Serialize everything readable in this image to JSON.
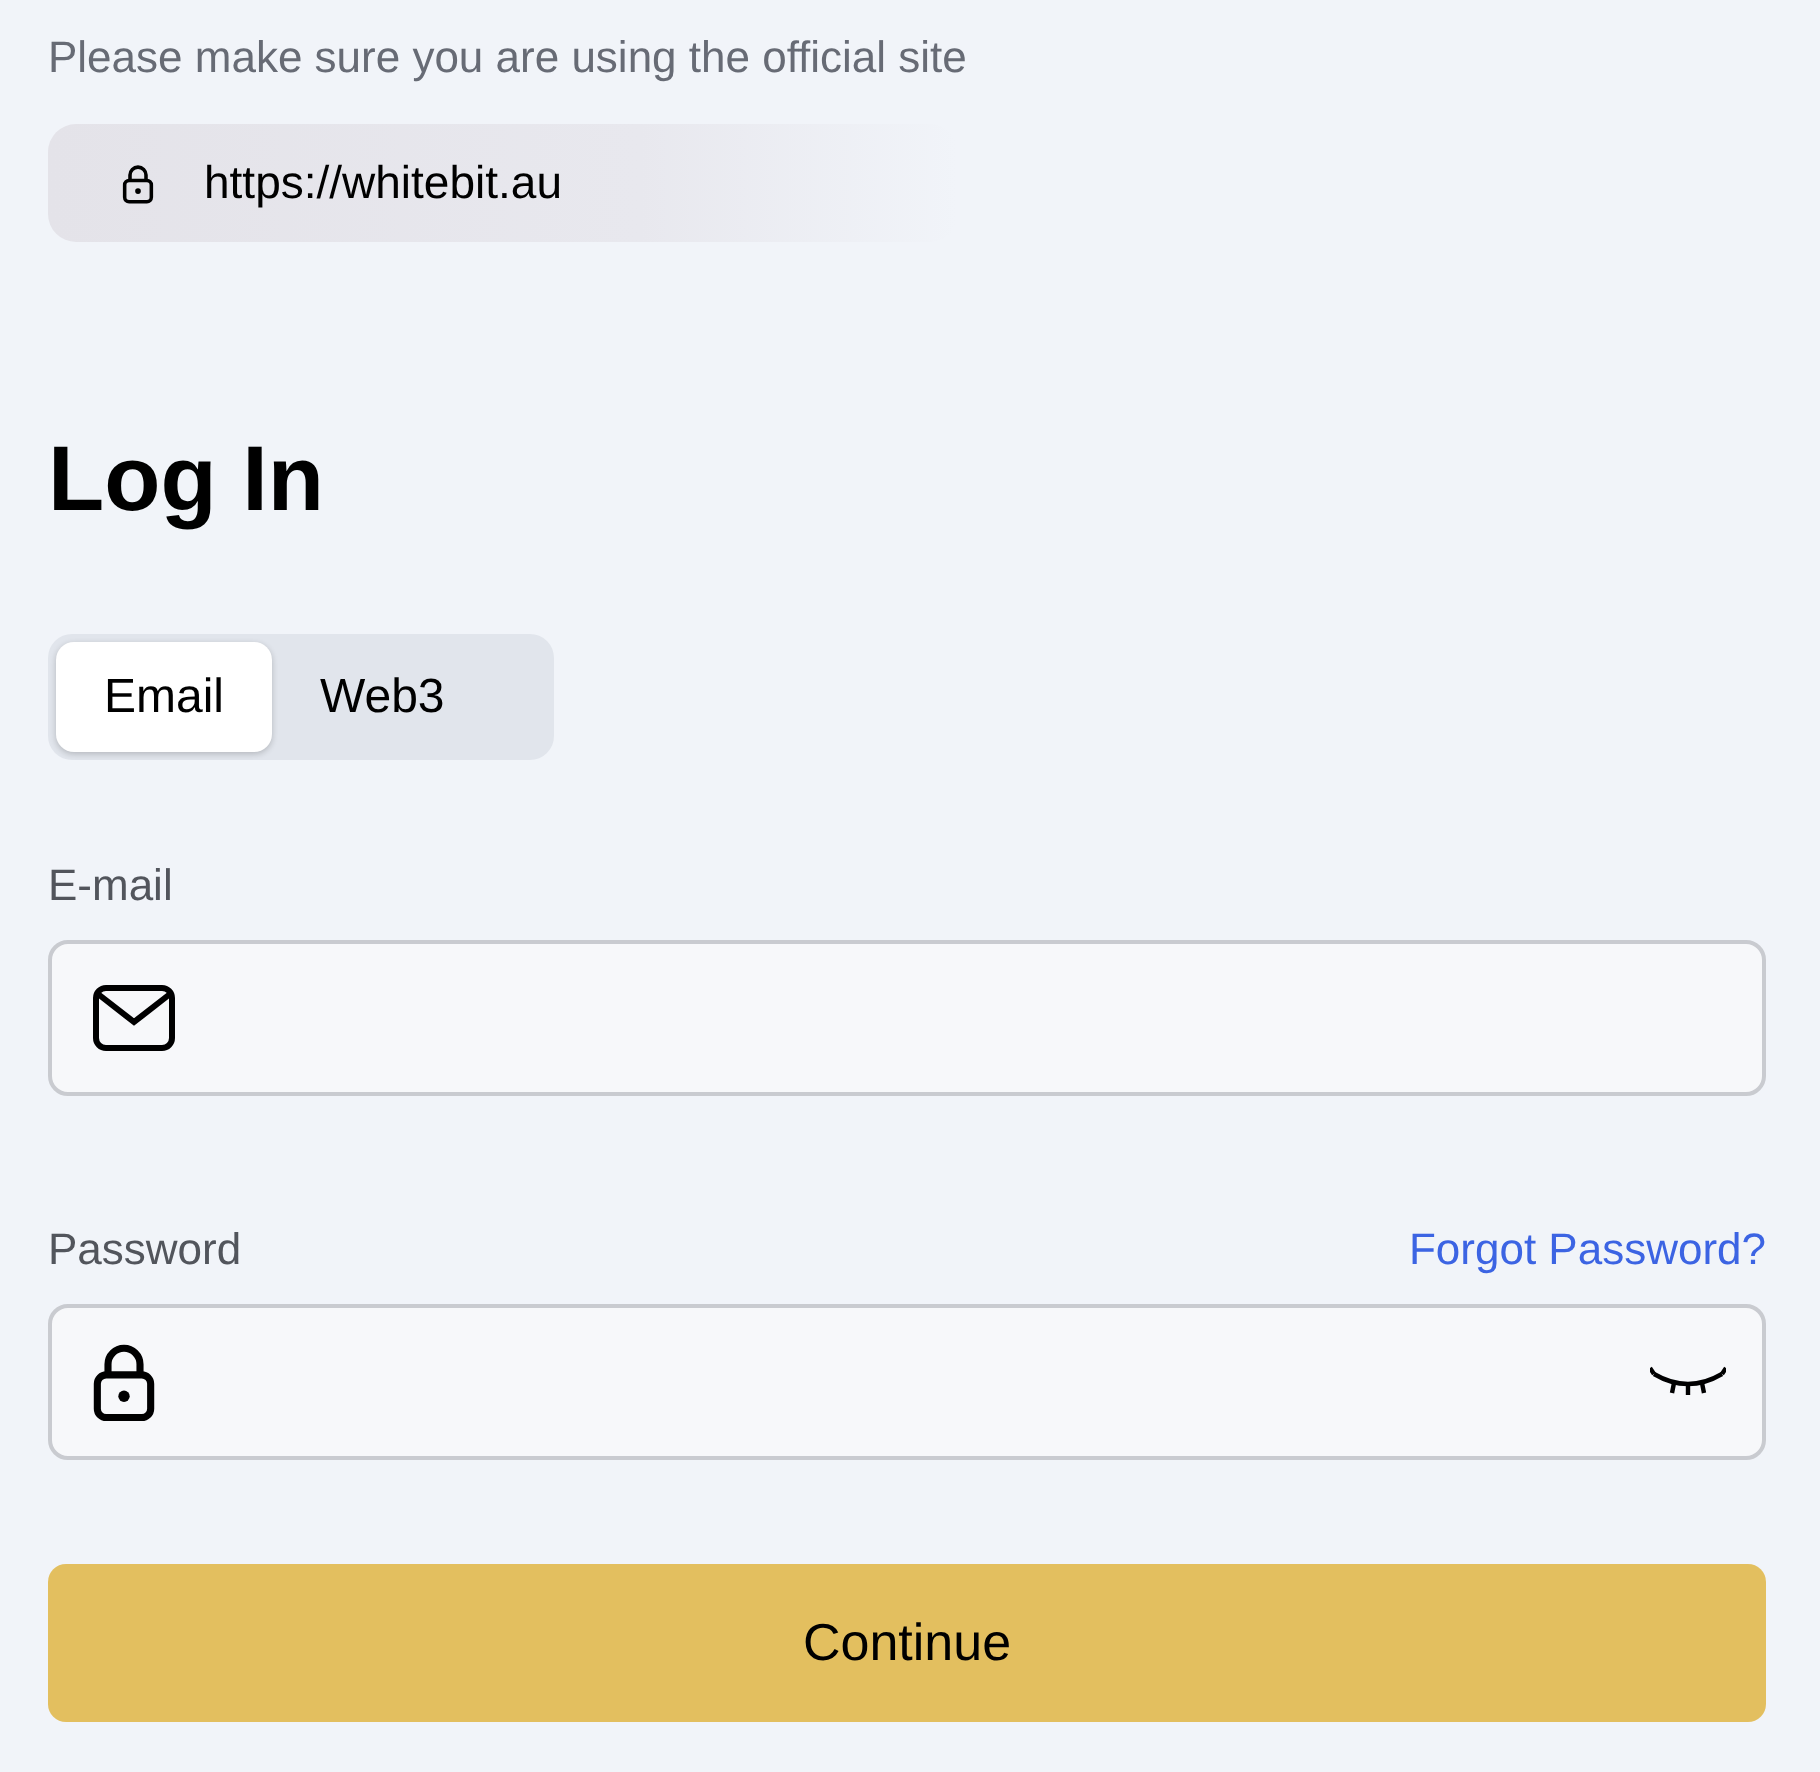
{
  "notice": "Please make sure you are using the official site",
  "site_url": "https://whitebit.au",
  "heading": "Log In",
  "tabs": [
    {
      "label": "Email",
      "selected": true
    },
    {
      "label": "Web3",
      "selected": false
    }
  ],
  "fields": [
    {
      "kind": "email",
      "label": "E-mail"
    },
    {
      "kind": "password",
      "label": "Password",
      "link": "Forgot Password?",
      "visible": false
    }
  ],
  "submit": "Continue"
}
